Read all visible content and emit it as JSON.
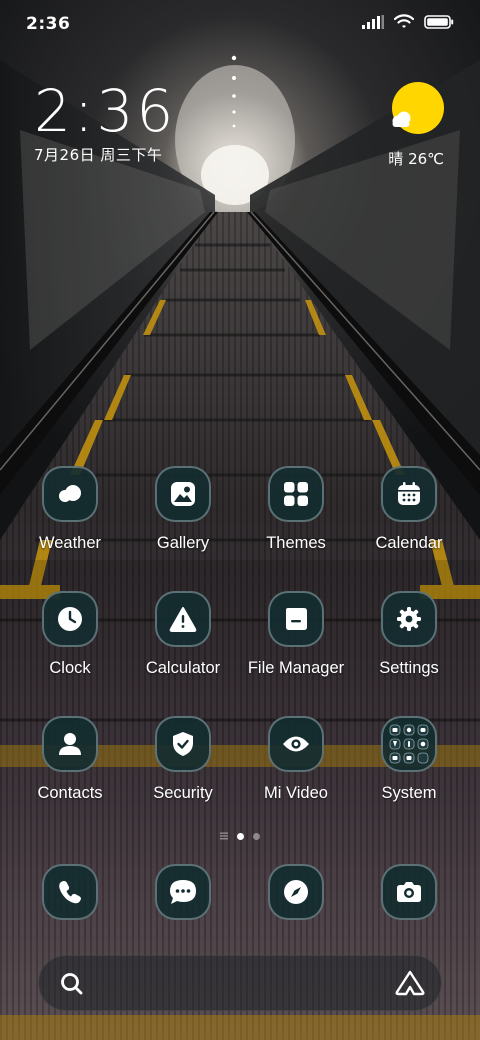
{
  "status_bar": {
    "time": "2:36",
    "icons": [
      "signal-icon",
      "wifi-icon",
      "battery-icon"
    ]
  },
  "clock_widget": {
    "time": "2:36",
    "date": "7月26日 周三下午"
  },
  "weather_widget": {
    "icon": "sun-cloud-icon",
    "text": "晴 26℃"
  },
  "apps": [
    {
      "label": "Weather",
      "icon": "weather-icon"
    },
    {
      "label": "Gallery",
      "icon": "gallery-icon"
    },
    {
      "label": "Themes",
      "icon": "themes-icon"
    },
    {
      "label": "Calendar",
      "icon": "calendar-icon"
    },
    {
      "label": "Clock",
      "icon": "clock-icon"
    },
    {
      "label": "Calculator",
      "icon": "calculator-icon"
    },
    {
      "label": "File Manager",
      "icon": "folder-icon"
    },
    {
      "label": "Settings",
      "icon": "gear-icon"
    },
    {
      "label": "Contacts",
      "icon": "person-icon"
    },
    {
      "label": "Security",
      "icon": "shield-icon"
    },
    {
      "label": "Mi Video",
      "icon": "eye-icon"
    },
    {
      "label": "System",
      "icon": "folder-grid-icon"
    }
  ],
  "page_indicator": {
    "pages": 3,
    "current": 2
  },
  "dock": [
    {
      "icon": "phone-icon"
    },
    {
      "icon": "message-icon"
    },
    {
      "icon": "compass-icon"
    },
    {
      "icon": "camera-icon"
    }
  ],
  "search_bar": {
    "left_icon": "search-icon",
    "right_icon": "assistant-icon"
  },
  "colors": {
    "icon_bg": "#142c30",
    "icon_border": "#96aaaf",
    "sun": "#ffd600"
  }
}
